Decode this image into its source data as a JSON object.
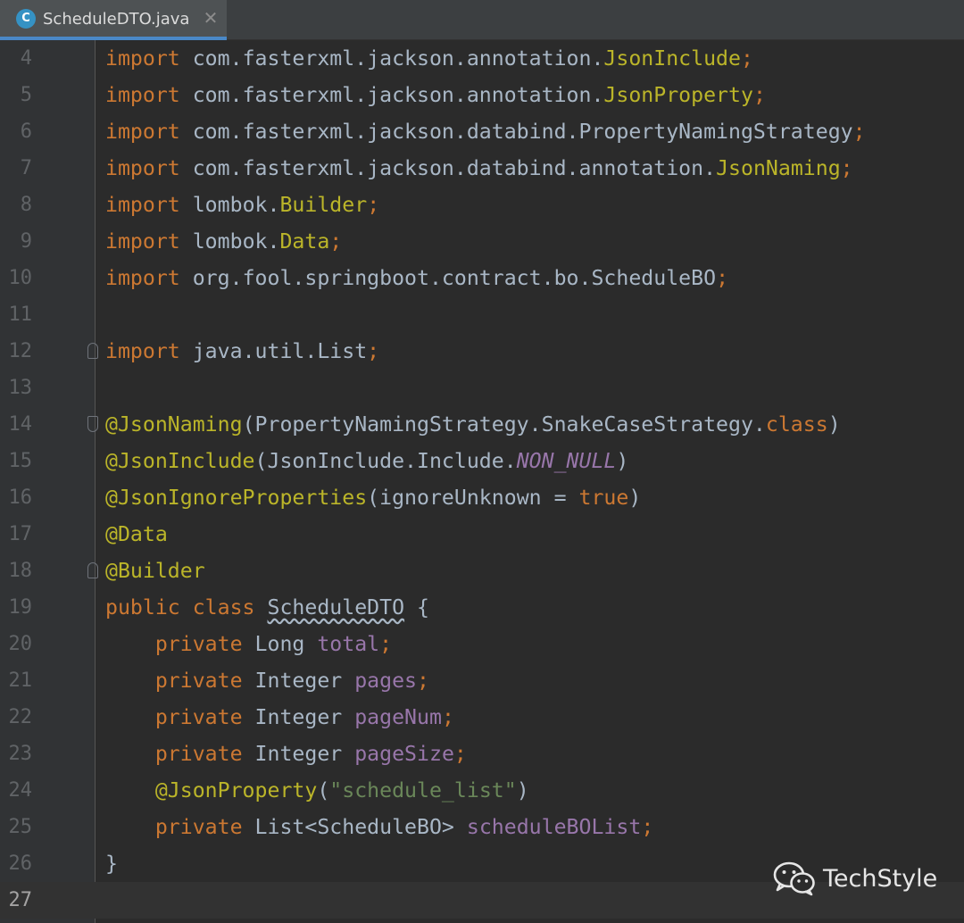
{
  "tab": {
    "icon_letter": "C",
    "icon_name": "class-icon",
    "title": "ScheduleDTO.java",
    "close_glyph": "✕"
  },
  "editor": {
    "current_line": "27",
    "lines": [
      {
        "num": "4",
        "tokens": [
          {
            "t": "import",
            "c": "kw"
          },
          {
            "t": " com.fasterxml.jackson.annotation.",
            "c": ""
          },
          {
            "t": "JsonInclude",
            "c": "an"
          },
          {
            "t": ";",
            "c": "kw"
          }
        ]
      },
      {
        "num": "5",
        "tokens": [
          {
            "t": "import",
            "c": "kw"
          },
          {
            "t": " com.fasterxml.jackson.annotation.",
            "c": ""
          },
          {
            "t": "JsonProperty",
            "c": "an"
          },
          {
            "t": ";",
            "c": "kw"
          }
        ]
      },
      {
        "num": "6",
        "tokens": [
          {
            "t": "import",
            "c": "kw"
          },
          {
            "t": " com.fasterxml.jackson.databind.PropertyNamingStrategy",
            "c": ""
          },
          {
            "t": ";",
            "c": "kw"
          }
        ]
      },
      {
        "num": "7",
        "tokens": [
          {
            "t": "import",
            "c": "kw"
          },
          {
            "t": " com.fasterxml.jackson.databind.annotation.",
            "c": ""
          },
          {
            "t": "JsonNaming",
            "c": "an"
          },
          {
            "t": ";",
            "c": "kw"
          }
        ]
      },
      {
        "num": "8",
        "tokens": [
          {
            "t": "import",
            "c": "kw"
          },
          {
            "t": " lombok.",
            "c": ""
          },
          {
            "t": "Builder",
            "c": "an"
          },
          {
            "t": ";",
            "c": "kw"
          }
        ]
      },
      {
        "num": "9",
        "tokens": [
          {
            "t": "import",
            "c": "kw"
          },
          {
            "t": " lombok.",
            "c": ""
          },
          {
            "t": "Data",
            "c": "an"
          },
          {
            "t": ";",
            "c": "kw"
          }
        ]
      },
      {
        "num": "10",
        "tokens": [
          {
            "t": "import",
            "c": "kw"
          },
          {
            "t": " org.fool.springboot.contract.bo.ScheduleBO",
            "c": ""
          },
          {
            "t": ";",
            "c": "kw"
          }
        ]
      },
      {
        "num": "11",
        "tokens": []
      },
      {
        "num": "12",
        "fold": "end",
        "tokens": [
          {
            "t": "import",
            "c": "kw"
          },
          {
            "t": " java.util.List",
            "c": ""
          },
          {
            "t": ";",
            "c": "kw"
          }
        ]
      },
      {
        "num": "13",
        "tokens": []
      },
      {
        "num": "14",
        "fold": "start",
        "tokens": [
          {
            "t": "@JsonNaming",
            "c": "an"
          },
          {
            "t": "(PropertyNamingStrategy.SnakeCaseStrategy.",
            "c": ""
          },
          {
            "t": "class",
            "c": "kw"
          },
          {
            "t": ")",
            "c": ""
          }
        ]
      },
      {
        "num": "15",
        "tokens": [
          {
            "t": "@JsonInclude",
            "c": "an"
          },
          {
            "t": "(JsonInclude.Include.",
            "c": ""
          },
          {
            "t": "NON_NULL",
            "c": "fi it"
          },
          {
            "t": ")",
            "c": ""
          }
        ]
      },
      {
        "num": "16",
        "tokens": [
          {
            "t": "@JsonIgnoreProperties",
            "c": "an"
          },
          {
            "t": "(ignoreUnknown = ",
            "c": ""
          },
          {
            "t": "true",
            "c": "kw"
          },
          {
            "t": ")",
            "c": ""
          }
        ]
      },
      {
        "num": "17",
        "tokens": [
          {
            "t": "@Data",
            "c": "an"
          }
        ]
      },
      {
        "num": "18",
        "fold": "end",
        "tokens": [
          {
            "t": "@Builder",
            "c": "an"
          }
        ]
      },
      {
        "num": "19",
        "tokens": [
          {
            "t": "public class ",
            "c": "kw"
          },
          {
            "t": "ScheduleDTO",
            "c": "squiggle"
          },
          {
            "t": " {",
            "c": ""
          }
        ]
      },
      {
        "num": "20",
        "tokens": [
          {
            "t": "    private ",
            "c": "kw"
          },
          {
            "t": "Long ",
            "c": ""
          },
          {
            "t": "total",
            "c": "fi"
          },
          {
            "t": ";",
            "c": "kw"
          }
        ]
      },
      {
        "num": "21",
        "tokens": [
          {
            "t": "    private ",
            "c": "kw"
          },
          {
            "t": "Integer ",
            "c": ""
          },
          {
            "t": "pages",
            "c": "fi"
          },
          {
            "t": ";",
            "c": "kw"
          }
        ]
      },
      {
        "num": "22",
        "tokens": [
          {
            "t": "    private ",
            "c": "kw"
          },
          {
            "t": "Integer ",
            "c": ""
          },
          {
            "t": "pageNum",
            "c": "fi"
          },
          {
            "t": ";",
            "c": "kw"
          }
        ]
      },
      {
        "num": "23",
        "tokens": [
          {
            "t": "    private ",
            "c": "kw"
          },
          {
            "t": "Integer ",
            "c": ""
          },
          {
            "t": "pageSize",
            "c": "fi"
          },
          {
            "t": ";",
            "c": "kw"
          }
        ]
      },
      {
        "num": "24",
        "tokens": [
          {
            "t": "    @JsonProperty",
            "c": "an"
          },
          {
            "t": "(",
            "c": ""
          },
          {
            "t": "\"schedule_list\"",
            "c": "st"
          },
          {
            "t": ")",
            "c": ""
          }
        ]
      },
      {
        "num": "25",
        "tokens": [
          {
            "t": "    private ",
            "c": "kw"
          },
          {
            "t": "List<ScheduleBO> ",
            "c": ""
          },
          {
            "t": "scheduleBOList",
            "c": "fi"
          },
          {
            "t": ";",
            "c": "kw"
          }
        ]
      },
      {
        "num": "26",
        "tokens": [
          {
            "t": "}",
            "c": ""
          }
        ]
      },
      {
        "num": "27",
        "tokens": []
      }
    ]
  },
  "colors": {
    "background": "#2b2b2b",
    "keyword": "#cc7832",
    "annotation": "#bbb529",
    "field": "#9876aa",
    "string": "#6a8759",
    "plain": "#a9b7c6",
    "tab_accent": "#4a88c7"
  },
  "watermark": {
    "icon_name": "wechat-icon",
    "text": "TechStyle"
  }
}
